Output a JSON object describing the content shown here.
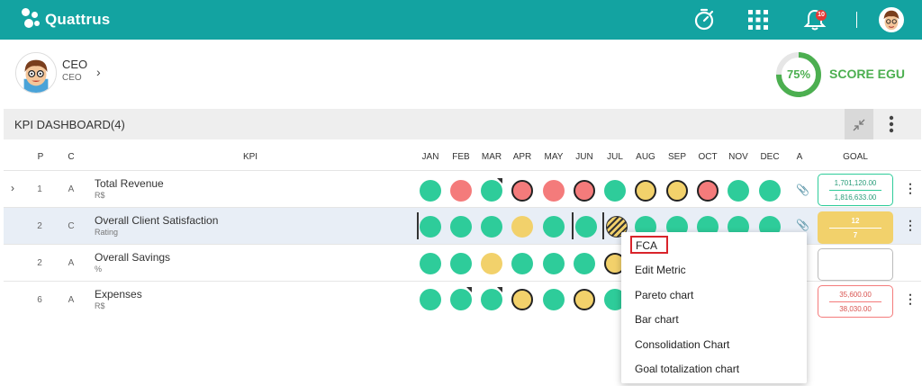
{
  "app": {
    "name": "Quattrus",
    "notification_count": "10"
  },
  "topbar_icons": [
    "timer-icon",
    "apps-grid-icon",
    "bell-icon",
    "user-avatar"
  ],
  "profile": {
    "name": "CEO",
    "role": "CEO"
  },
  "score": {
    "percent": "75%",
    "value": 0.75,
    "label": "SCORE EGU",
    "color": "#4caf50"
  },
  "dashboard": {
    "title": "KPI DASHBOARD(4)"
  },
  "columns": {
    "p": "P",
    "c": "C",
    "kpi": "KPI",
    "months": [
      "JAN",
      "FEB",
      "MAR",
      "APR",
      "MAY",
      "JUN",
      "JUL",
      "AUG",
      "SEP",
      "OCT",
      "NOV",
      "DEC"
    ],
    "a": "A",
    "goal": "GOAL"
  },
  "rows": [
    {
      "p": "1",
      "c": "A",
      "name": "Total Revenue",
      "unit": "R$",
      "goal_top": "1,701,120.00",
      "goal_bottom": "1,816,633.00",
      "goal_status": "green"
    },
    {
      "p": "2",
      "c": "C",
      "name": "Overall Client Satisfaction",
      "unit": "Rating",
      "goal_top": "12",
      "goal_bottom": "7",
      "goal_status": "yellow"
    },
    {
      "p": "2",
      "c": "A",
      "name": "Overall Savings",
      "unit": "%",
      "goal_top": "",
      "goal_bottom": "",
      "goal_status": "empty"
    },
    {
      "p": "6",
      "c": "A",
      "name": "Expenses",
      "unit": "R$",
      "goal_top": "35,600.00",
      "goal_bottom": "38,030.00",
      "goal_status": "red"
    }
  ],
  "context_menu": {
    "items": [
      "FCA",
      "Edit Metric",
      "Pareto chart",
      "Bar chart",
      "Consolidation Chart",
      "Goal totalization chart"
    ]
  },
  "colors": {
    "brand": "#13a3a1",
    "green": "#2ecc9a",
    "red": "#f47b7b",
    "yellow": "#f2d16b"
  }
}
